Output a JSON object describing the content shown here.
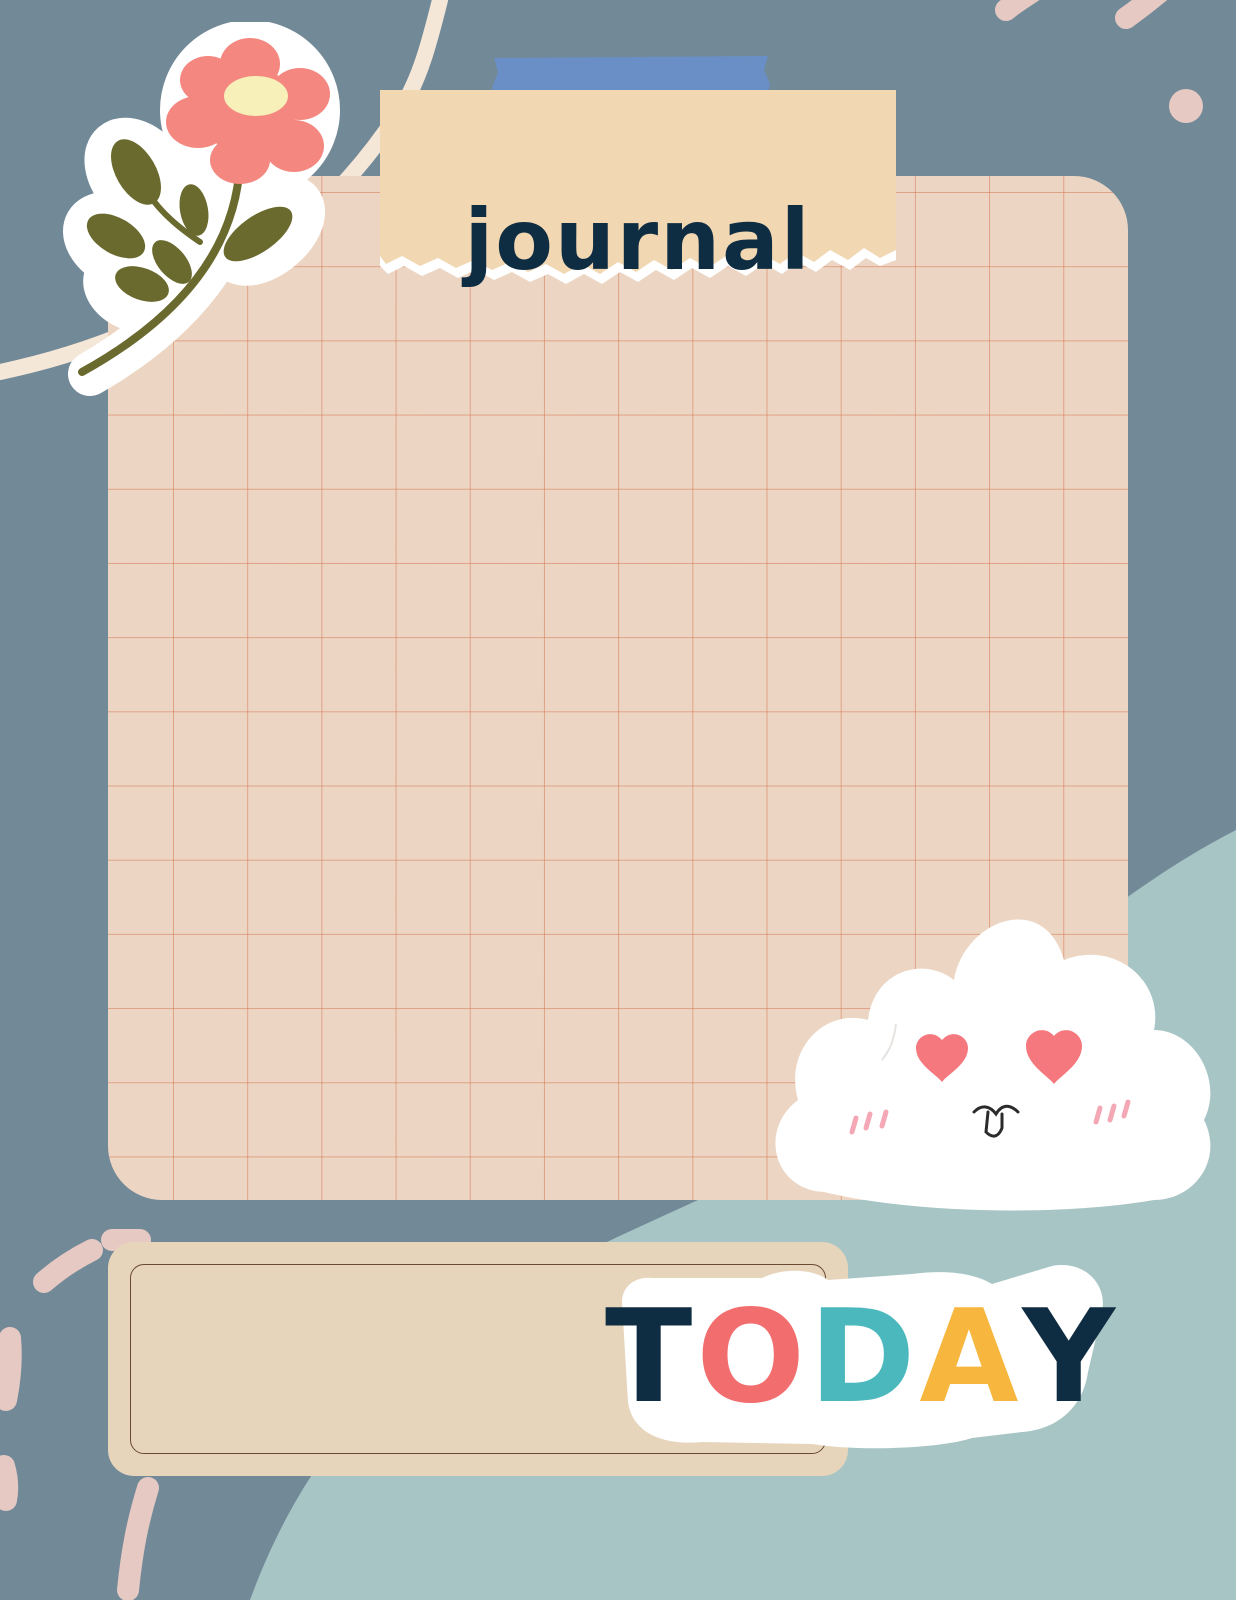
{
  "colors": {
    "background_slate": "#728998",
    "background_mint": "#a8c5c5",
    "paper": "#ecd6c3",
    "grid_lines": "#d67654",
    "note_paper": "#f1d7b2",
    "tape": "#6a8fc6",
    "ink_dark": "#0f2d42",
    "dash_pink": "#e6c9c2",
    "cream_arc": "#f5e7d8"
  },
  "header": {
    "title": "journal"
  },
  "footer": {
    "today_letters": [
      {
        "char": "T",
        "color": "#0f2d42"
      },
      {
        "char": "O",
        "color": "#f26e6e"
      },
      {
        "char": "D",
        "color": "#4bb8bd"
      },
      {
        "char": "A",
        "color": "#f7b73e"
      },
      {
        "char": "Y",
        "color": "#0f2d42"
      }
    ],
    "date_field_value": ""
  },
  "stickers": {
    "flower": "flower-sticker-icon",
    "cloud": "cloud-heart-eyes-sticker-icon"
  }
}
